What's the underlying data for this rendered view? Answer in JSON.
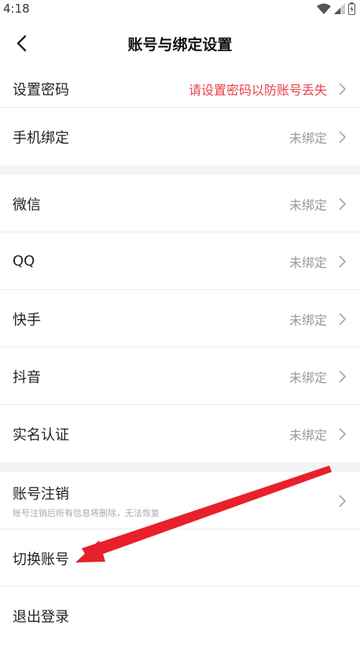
{
  "status_bar": {
    "time": "4:18"
  },
  "header": {
    "title": "账号与绑定设置"
  },
  "group1": [
    {
      "label": "设置密码",
      "value": "请设置密码以防账号丢失"
    },
    {
      "label": "手机绑定",
      "value": "未绑定"
    }
  ],
  "group2": [
    {
      "label": "微信",
      "value": "未绑定"
    },
    {
      "label": "QQ",
      "value": "未绑定"
    },
    {
      "label": "快手",
      "value": "未绑定"
    },
    {
      "label": "抖音",
      "value": "未绑定"
    },
    {
      "label": "实名认证",
      "value": "未绑定"
    }
  ],
  "group3": {
    "cancel": {
      "label": "账号注销",
      "subtitle": "账号注销后所有信息将删除，无法恢复"
    },
    "switch": {
      "label": "切换账号"
    },
    "logout": {
      "label": "退出登录"
    }
  },
  "colors": {
    "warning": "#e8404a",
    "annotation_arrow": "#e8202a"
  }
}
